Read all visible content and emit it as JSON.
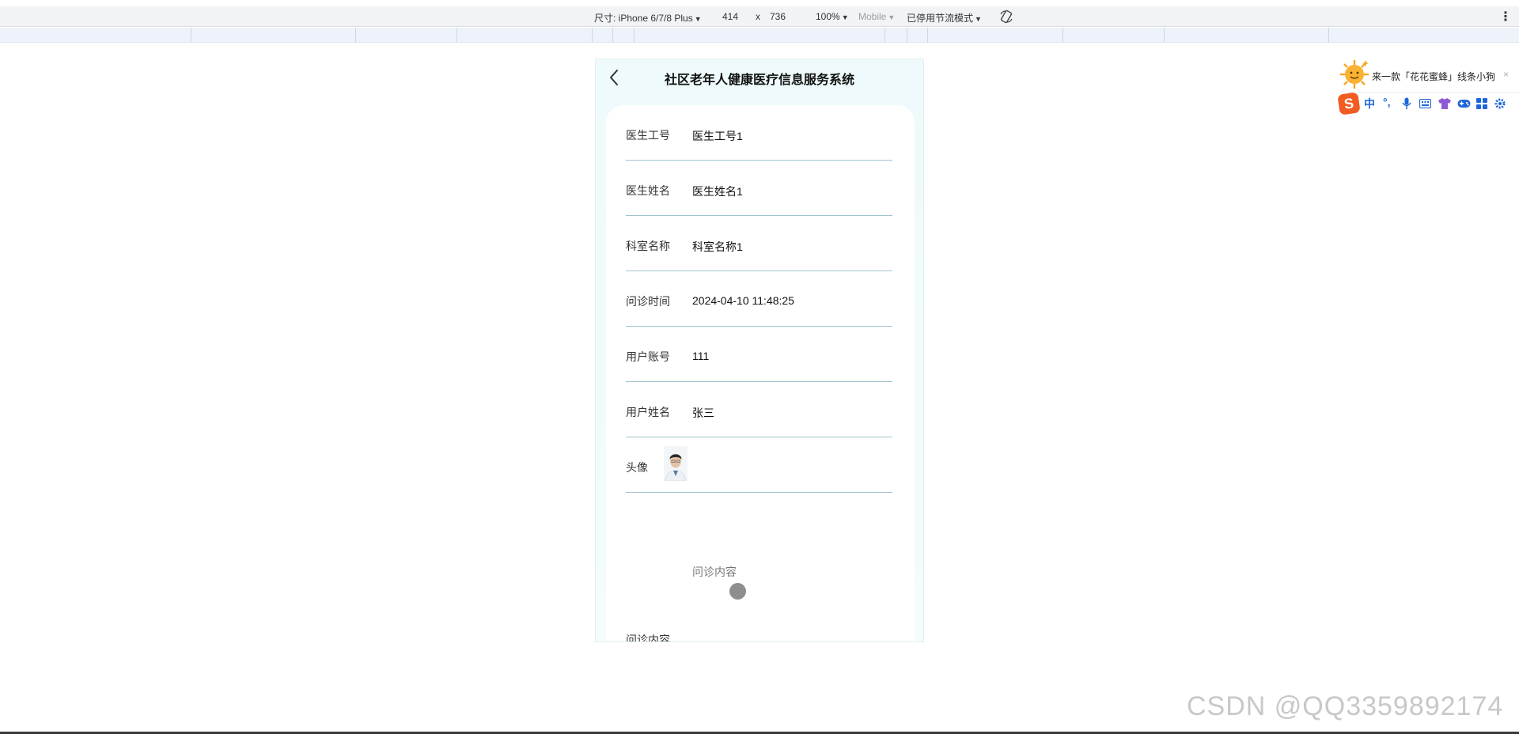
{
  "devtools": {
    "size_label": "尺寸: iPhone 6/7/8 Plus",
    "width": "414",
    "times": "x",
    "height": "736",
    "zoom": "100%",
    "mode": "Mobile",
    "throttle": "已停用节流模式",
    "caret": "▼",
    "kebab": "⋮"
  },
  "app": {
    "title": "社区老年人健康医疗信息服务系统",
    "back_icon": "chevron-left-icon"
  },
  "form": {
    "fields": [
      {
        "label": "医生工号",
        "value": "医生工号1"
      },
      {
        "label": "医生姓名",
        "value": "医生姓名1"
      },
      {
        "label": "科室名称",
        "value": "科室名称1"
      },
      {
        "label": "问诊时间",
        "value": "2024-04-10 11:48:25"
      },
      {
        "label": "用户账号",
        "value": "111"
      },
      {
        "label": "用户姓名",
        "value": "张三"
      }
    ],
    "avatar_label": "头像",
    "content_placeholder": "问诊内容",
    "content_label": "问诊内容"
  },
  "ime": {
    "tip": "来一款「花花蜜蜂」线条小狗",
    "close": "×",
    "logo": "S",
    "zh": "中",
    "punct": "°,",
    "icons": [
      "mic-icon",
      "keyboard-icon",
      "shirt-icon",
      "gamepad-icon",
      "grid-icon",
      "gear-icon"
    ]
  },
  "watermark": "CSDN @QQ3359892174",
  "colors": {
    "accent": "#1d65d8",
    "divider": "#9fc3ce",
    "ime_orange": "#f25c22"
  }
}
